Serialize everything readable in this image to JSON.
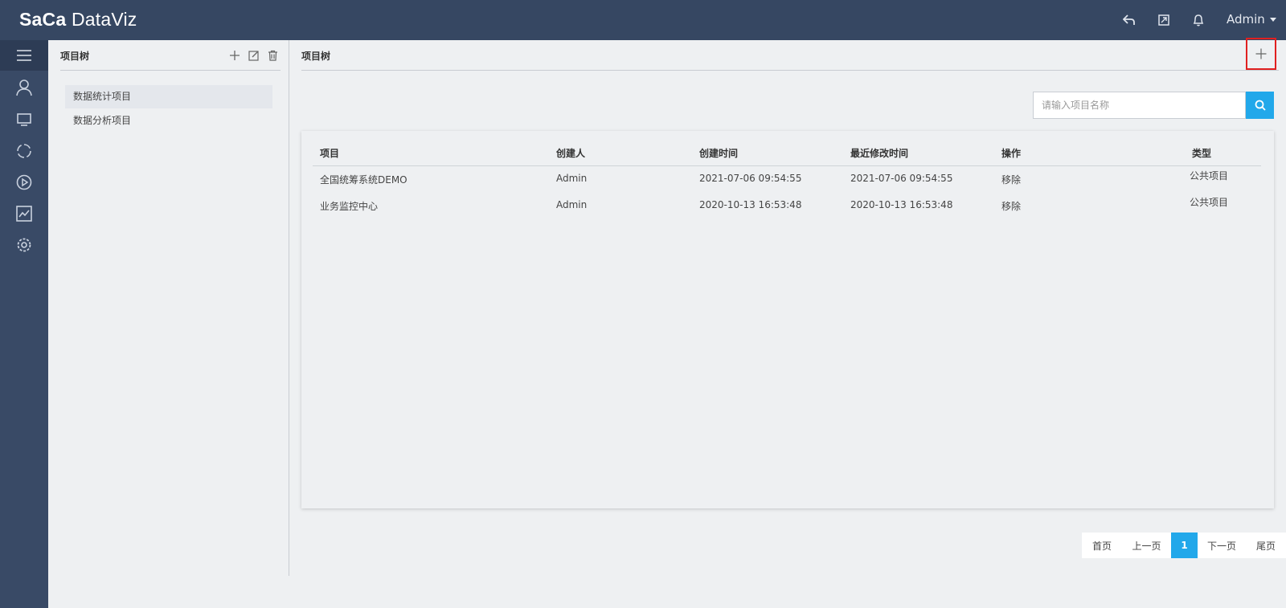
{
  "header": {
    "logo_text": "SaCa",
    "product_name": "DataViz",
    "user_label": "Admin",
    "icons": [
      "back-icon",
      "external-link-icon",
      "bell-icon"
    ]
  },
  "rail": {
    "icons": [
      "menu-icon",
      "user-icon",
      "monitor-icon",
      "sync-icon",
      "play-icon",
      "chart-icon",
      "settings-icon"
    ]
  },
  "tree": {
    "title": "项目树",
    "items": [
      {
        "label": "数据统计项目"
      },
      {
        "label": "数据分析项目"
      }
    ]
  },
  "main": {
    "title": "项目树",
    "search_placeholder": "请输入项目名称",
    "columns": [
      "项目",
      "创建人",
      "创建时间",
      "最近修改时间",
      "操作",
      "类型"
    ],
    "rows": [
      {
        "name": "全国统筹系统DEMO",
        "creator": "Admin",
        "created": "2021-07-06 09:54:55",
        "modified": "2021-07-06 09:54:55",
        "action": "移除",
        "type": "公共项目"
      },
      {
        "name": "业务监控中心",
        "creator": "Admin",
        "created": "2020-10-13 16:53:48",
        "modified": "2020-10-13 16:53:48",
        "action": "移除",
        "type": "公共项目"
      }
    ]
  },
  "pagination": {
    "first": "首页",
    "prev": "上一页",
    "current": "1",
    "next": "下一页",
    "last": "尾页"
  },
  "colors": {
    "topbar": "#364762",
    "rail": "#394a66",
    "accent": "#22a8ea",
    "highlight": "#e02020"
  }
}
